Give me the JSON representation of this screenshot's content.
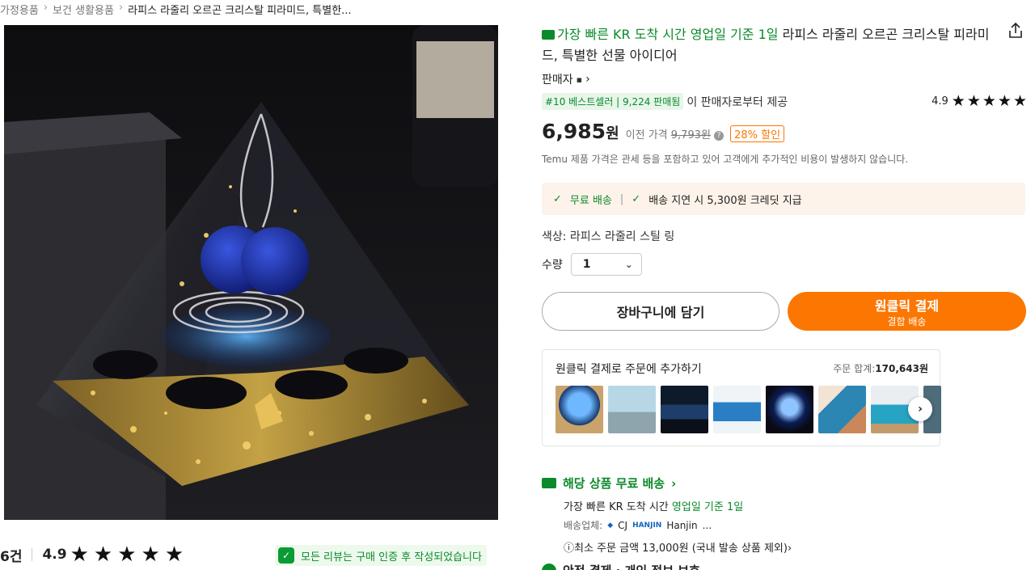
{
  "breadcrumb": {
    "items": [
      "가정용품",
      "보건 생활용품",
      "라피스 라줄리 오르곤 크리스탈 피라미드, 특별한..."
    ],
    "separator": "›"
  },
  "product": {
    "speed_badge": "가장 빠른 KR 도착 시간 영업일 기준 1일",
    "title": "라피스 라줄리 오르곤 크리스탈 피라미드, 특별한 선물 아이디어",
    "seller_label": "판매자",
    "best_badge": "#10 베스트셀러 | 9,224 판매됨",
    "best_suffix": "이 판매자로부터 제공",
    "rating": "4.9",
    "stars": 5,
    "price": "6,985",
    "price_unit": "원",
    "was_label": "이전 가격",
    "was_price": "9,793원",
    "discount": "28% 할인",
    "tax_note": "Temu 제품 가격은 관세 등을 포함하고 있어 고객에게 추가적인 비용이 발생하지 않습니다."
  },
  "shipping_banner": {
    "free": "무료 배송",
    "divider": "|",
    "credit": "배송 지연 시 5,300원 크레딧 지급"
  },
  "options": {
    "color_line": "색상: 라피스 라줄리 스틸 링",
    "qty_label": "수량",
    "qty_value": "1"
  },
  "buttons": {
    "cart": "장바구니에 담기",
    "buy_main": "원클릭 결제",
    "buy_sub": "결합 배송"
  },
  "addon": {
    "title": "원클릭 결제로 주문에 추가하기",
    "total_label": "주문 합계:",
    "total_value": "170,643원"
  },
  "delivery": {
    "head": "해당 상품 무료 배송",
    "line1_prefix": "가장 빠른 KR 도착 시간",
    "line1_green": "영업일 기준 1일",
    "carrier_label": "배송업체:",
    "carrier_cj": "CJ",
    "carrier_hanjin_logo": "HANJIN",
    "carrier_hanjin": "Hanjin",
    "carrier_more": "...",
    "min_order": "ⓘ최소 주문 금액 13,000원 (국내 발송 상품 제외)",
    "min_order_arrow": "›",
    "next_section": "안전 결제 · 개인 정보 보호"
  },
  "reviews": {
    "count": "6건",
    "score": "4.9",
    "stars": 5,
    "verify_note": "모든 리뷰는 구매 인증 후 작성되었습니다"
  },
  "icons": {
    "share": "share-icon",
    "star": "★",
    "check": "✓",
    "chevron_right": "›",
    "chevron_down": "⌄"
  },
  "colors": {
    "accent_orange": "#fb7701",
    "green": "#0a8a2a",
    "banner_bg": "#fdf3ea"
  }
}
